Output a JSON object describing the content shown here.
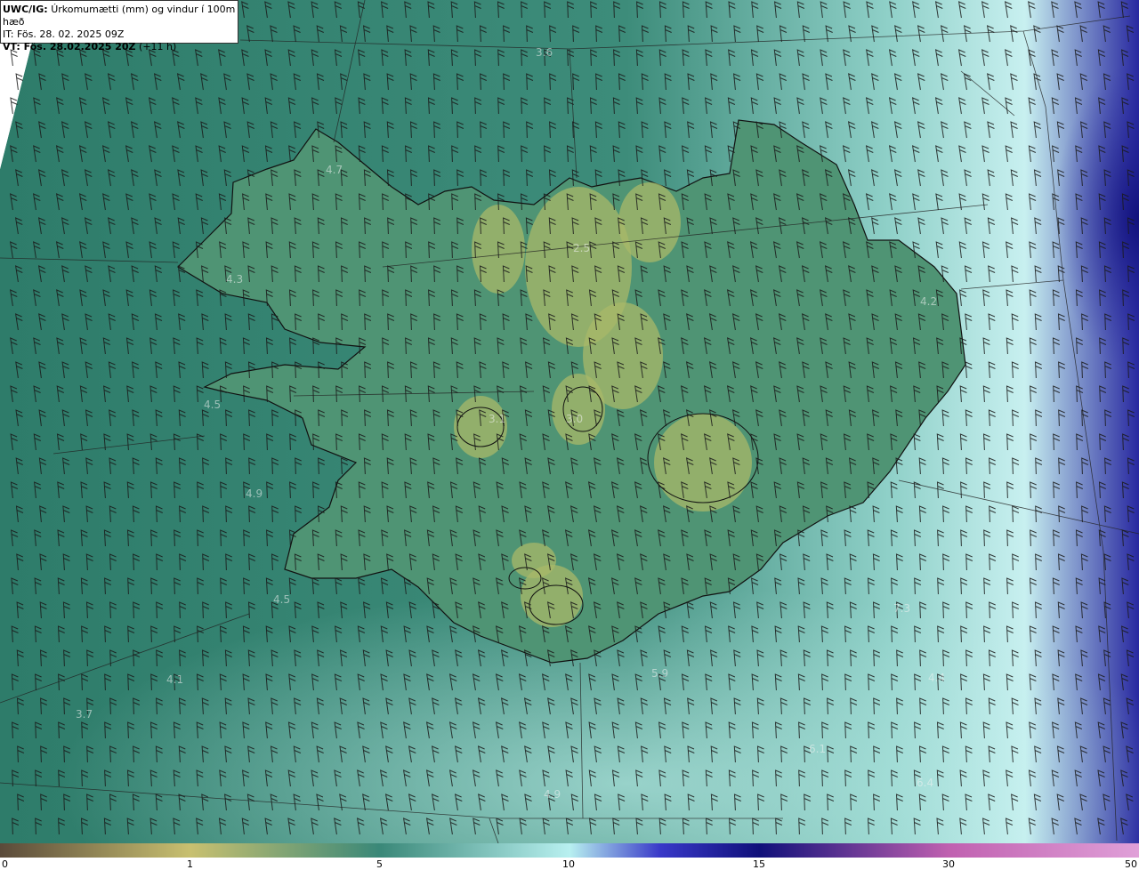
{
  "header": {
    "model_prefix": "UWC/IG:",
    "title": "Úrkomumætti (mm) og vindur í 100m hæð",
    "init_time": "IT: Fös. 28. 02. 2025 09Z",
    "valid_prefix": "VT: Fös. 28.02.2025 20Z",
    "valid_suffix": "(+11 h)"
  },
  "map_values": [
    {
      "text": "3.6"
    },
    {
      "text": "4.7"
    },
    {
      "text": "2.5"
    },
    {
      "text": "4.3"
    },
    {
      "text": "4.2"
    },
    {
      "text": "4.5"
    },
    {
      "text": "3.1"
    },
    {
      "text": "3.0"
    },
    {
      "text": "4.9"
    },
    {
      "text": "4.5"
    },
    {
      "text": "5.9"
    },
    {
      "text": "4.1"
    },
    {
      "text": "3.7"
    },
    {
      "text": "6.1"
    },
    {
      "text": "6.4"
    },
    {
      "text": "4.9"
    },
    {
      "text": "7.3"
    },
    {
      "text": "4.4"
    }
  ],
  "colorbar": {
    "ticks": [
      "0",
      "1",
      "5",
      "10",
      "15",
      "30",
      "50"
    ],
    "colors": [
      "#5a4a3a",
      "#c8c070",
      "#6aa888",
      "#3a8878",
      "#b8f0f0",
      "#3838c8",
      "#10107a",
      "#c060b0",
      "#e0a0d8"
    ]
  },
  "colors": {
    "sea_field": "#2e7a6a",
    "land_field": "#4f9474",
    "highland": "#a8b868",
    "heavy_precip": "#2a2aa0",
    "coastline": "#111111"
  }
}
